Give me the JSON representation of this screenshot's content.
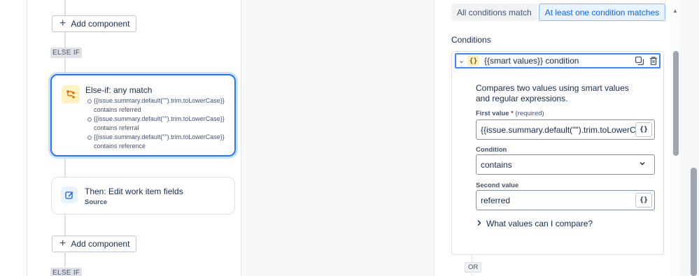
{
  "canvas": {
    "add_component_top": "Add component",
    "add_component_bottom": "Add component",
    "else_if_1": "ELSE IF",
    "else_if_2": "ELSE IF",
    "active_card": {
      "title": "Else-if: any match",
      "icon": "branch-icon",
      "conditions": [
        "{{issue.summary.default(\"\").trim.toLowerCase}} contains referred",
        "{{issue.summary.default(\"\").trim.toLowerCase}} contains referral",
        "{{issue.summary.default(\"\").trim.toLowerCase}} contains reference"
      ]
    },
    "then_card": {
      "title": "Then: Edit work item fields",
      "subtitle": "Source",
      "icon": "edit-icon"
    }
  },
  "panel": {
    "toggle": {
      "option_all": "All conditions match",
      "option_any": "At least one condition matches",
      "selected": "At least one condition matches"
    },
    "conditions_heading": "Conditions",
    "condition": {
      "badge": "{}",
      "title": "{{smart values}} condition",
      "description": "Compares two values using smart values and regular expressions.",
      "first_value_label": "First value",
      "required_mark": "*",
      "required_text": "(required)",
      "first_value": "{{issue.summary.default(\"\").trim.toLowerCase}}",
      "condition_label": "Condition",
      "condition_value": "contains",
      "second_value_label": "Second value",
      "second_value": "referred",
      "smart_value_button": "{}",
      "help_link": "What values can I compare?"
    },
    "or_label": "OR"
  },
  "colors": {
    "accent": "#1d7afc",
    "selected_bg": "#e9f2ff",
    "badge_yellow": "#fff1c2"
  }
}
